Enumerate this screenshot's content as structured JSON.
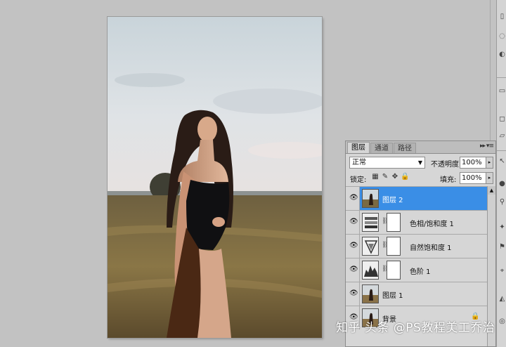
{
  "panel": {
    "tabs": [
      "图层",
      "通道",
      "路径"
    ],
    "menu_icon": "panel-menu-icon",
    "blend_mode": "正常",
    "opacity_label": "不透明度:",
    "opacity_value": "100%",
    "lock_label": "锁定:",
    "fill_label": "填充:",
    "fill_value": "100%"
  },
  "layers": [
    {
      "name": "图层 2",
      "selected": true,
      "kind": "photo"
    },
    {
      "name": "色相/饱和度 1",
      "selected": false,
      "kind": "hue-saturation"
    },
    {
      "name": "自然饱和度 1",
      "selected": false,
      "kind": "vibrance"
    },
    {
      "name": "色阶 1",
      "selected": false,
      "kind": "levels"
    },
    {
      "name": "图层 1",
      "selected": false,
      "kind": "photo"
    },
    {
      "name": "背景",
      "selected": false,
      "kind": "photo"
    }
  ],
  "watermark": "知乎 头条 @PS教程美工乔治",
  "colors": {
    "selection": "#3a8ee6",
    "workspace": "#c2c2c2"
  }
}
